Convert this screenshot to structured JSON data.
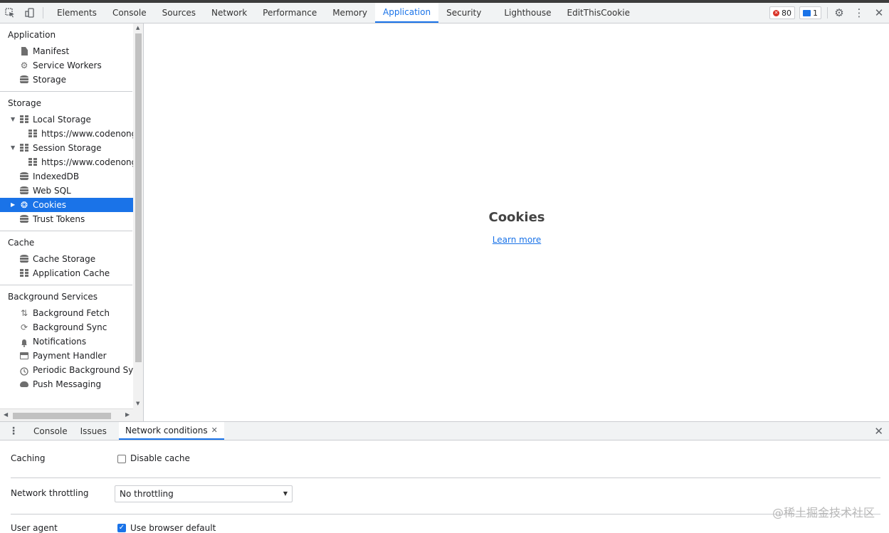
{
  "toolbar": {
    "tabs": [
      "Elements",
      "Console",
      "Sources",
      "Network",
      "Performance",
      "Memory",
      "Application",
      "Security",
      "Lighthouse",
      "EditThisCookie"
    ],
    "active_tab": "Application",
    "error_count": "80",
    "message_count": "1"
  },
  "sidebar": {
    "application": {
      "title": "Application",
      "items": [
        "Manifest",
        "Service Workers",
        "Storage"
      ]
    },
    "storage": {
      "title": "Storage",
      "local_storage": "Local Storage",
      "local_origin": "https://www.codenong.",
      "session_storage": "Session Storage",
      "session_origin": "https://www.codenong.",
      "indexeddb": "IndexedDB",
      "websql": "Web SQL",
      "cookies": "Cookies",
      "trust_tokens": "Trust Tokens"
    },
    "cache": {
      "title": "Cache",
      "items": [
        "Cache Storage",
        "Application Cache"
      ]
    },
    "background": {
      "title": "Background Services",
      "items": [
        "Background Fetch",
        "Background Sync",
        "Notifications",
        "Payment Handler",
        "Periodic Background Sync",
        "Push Messaging"
      ]
    }
  },
  "main": {
    "title": "Cookies",
    "learn_more": "Learn more"
  },
  "drawer": {
    "tabs": [
      "Console",
      "Issues"
    ],
    "active_tab": "Network conditions",
    "caching_label": "Caching",
    "disable_cache_label": "Disable cache",
    "disable_cache_checked": false,
    "throttling_label": "Network throttling",
    "throttling_value": "No throttling",
    "user_agent_label": "User agent",
    "use_default_label": "Use browser default",
    "use_default_checked": true
  },
  "watermark": "@稀土掘金技术社区",
  "colors": {
    "accent": "#1a73e8",
    "error": "#d93025",
    "toolbar_bg": "#f1f3f4"
  }
}
